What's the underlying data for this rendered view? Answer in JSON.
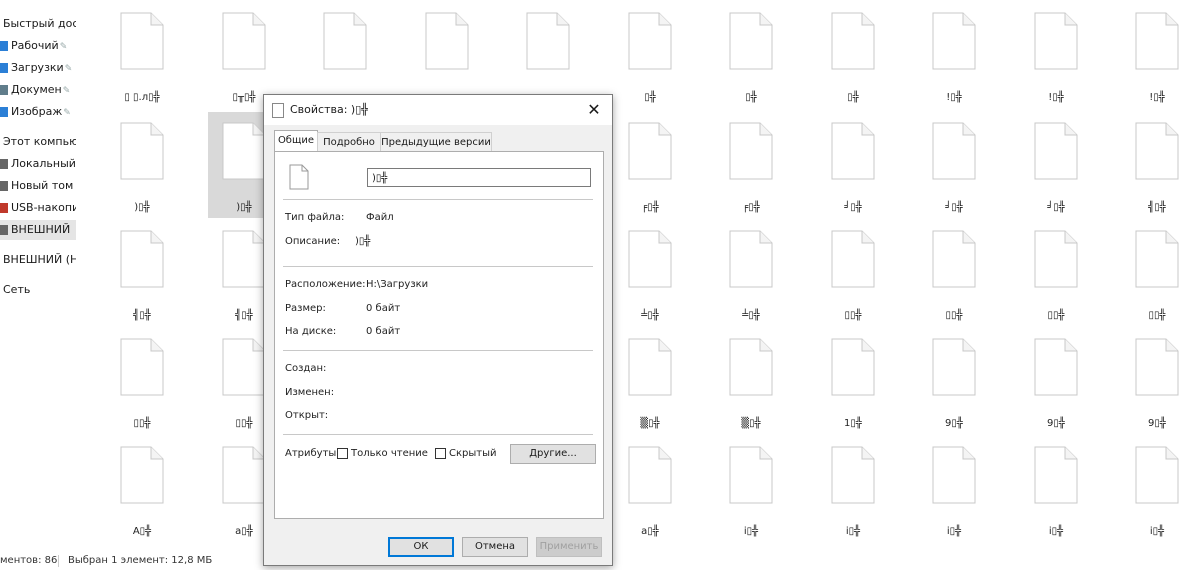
{
  "nav": {
    "items": [
      {
        "label": "Быстрый дос",
        "icon": "star-icon",
        "pinned": false
      },
      {
        "label": "Рабочий",
        "icon": "desktop-icon",
        "pinned": true
      },
      {
        "label": "Загрузки",
        "icon": "download-arrow-icon",
        "pinned": true
      },
      {
        "label": "Докумен",
        "icon": "document-icon",
        "pinned": true
      },
      {
        "label": "Изображ",
        "icon": "image-icon",
        "pinned": true
      },
      {
        "label": "Этот компью",
        "icon": "computer-icon",
        "pinned": false
      },
      {
        "label": "Локальный",
        "icon": "drive-icon",
        "pinned": false
      },
      {
        "label": "Новый том",
        "icon": "drive-icon",
        "pinned": false
      },
      {
        "label": "USB-накопи",
        "icon": "usb-drive-icon",
        "pinned": false
      },
      {
        "label": "ВНЕШНИЙ",
        "icon": "drive-icon",
        "pinned": false
      },
      {
        "label": "ВНЕШНИЙ (Н",
        "icon": "drive-icon",
        "pinned": false
      },
      {
        "label": "Сеть",
        "icon": "network-icon",
        "pinned": false
      }
    ],
    "pin_glyph": "✎"
  },
  "files": [
    [
      "▯ ▯.л▯╬",
      "▯╥▯╬",
      "",
      "",
      "",
      "▯╬",
      "▯╬",
      "▯╬",
      "!▯╬",
      "!▯╬",
      "!▯╬"
    ],
    [
      ")▯╬",
      ")▯╬",
      "",
      "",
      "",
      "╒▯╬",
      "╒▯╬",
      "╛▯╬",
      "╛▯╬",
      "╛▯╬",
      "╣▯╬"
    ],
    [
      "╣▯╬",
      "╣▯╬",
      "",
      "",
      "",
      "╧▯╬",
      "╧▯╬",
      "▯▯╬",
      "▯▯╬",
      "▯▯╬",
      "▯▯╬"
    ],
    [
      "▯▯╬",
      "▯▯╬",
      "",
      "",
      "",
      "▒▯╬",
      "▒▯╬",
      "1▯╬",
      "9▯╬",
      "9▯╬",
      "9▯╬"
    ],
    [
      "A▯╬",
      "a▯╬",
      "",
      "",
      "",
      "a▯╬",
      "i▯╬",
      "i▯╬",
      "i▯╬",
      "i▯╬",
      "i▯╬"
    ]
  ],
  "status": {
    "count": "ментов: 86",
    "selection": "Выбран 1 элемент: 12,8 МБ"
  },
  "dialog": {
    "title": "Свойства: )▯╬",
    "close": "✕",
    "tabs": [
      {
        "label": "Общие",
        "active": true
      },
      {
        "label": "Подробно",
        "active": false
      },
      {
        "label": "Предыдущие версии",
        "active": false
      }
    ],
    "name_value": ")▯╬",
    "file_type_label": "Тип файла:",
    "file_type_value": "Файл",
    "description_label": "Описание:",
    "description_value": ")▯╬",
    "location_label": "Расположение:",
    "location_value": "H:\\Загрузки",
    "size_label": "Размер:",
    "size_value": "0 байт",
    "disk_label": "На диске:",
    "disk_value": "0 байт",
    "created_label": "Создан:",
    "modified_label": "Изменен:",
    "opened_label": "Открыт:",
    "attributes_label": "Атрибуты:",
    "readonly_label": "Только чтение",
    "hidden_label": "Скрытый",
    "other_button": "Другие...",
    "ok_button": "ОК",
    "cancel_button": "Отмена",
    "apply_button": "Применить"
  },
  "colors": {
    "accent": "#0078d7",
    "selection": "#d9d9d9",
    "usb": "#c0392b"
  }
}
